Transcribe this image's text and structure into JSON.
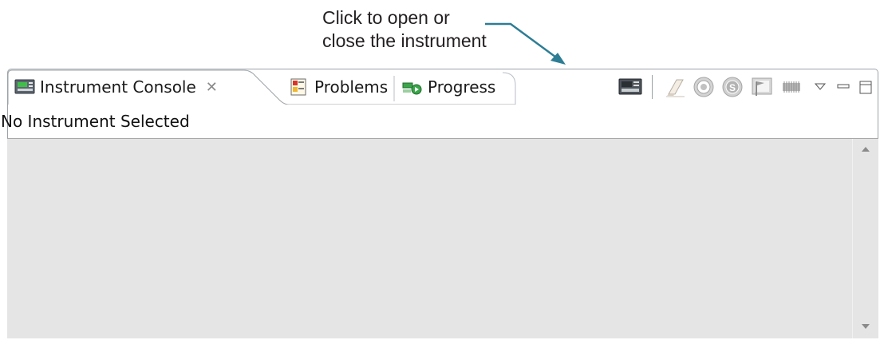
{
  "callout": {
    "line1": "Click to open or",
    "line2": "close the instrument"
  },
  "tabs": [
    {
      "label": "Instrument Console",
      "icon": "instrument-console-icon",
      "active": true,
      "close_glyph": "✕"
    },
    {
      "label": "Problems",
      "icon": "problems-icon",
      "active": false
    },
    {
      "label": "Progress",
      "icon": "progress-icon",
      "active": false
    }
  ],
  "toolbar": {
    "buttons": [
      {
        "name": "open-close-instrument-button",
        "icon": "instrument-icon"
      },
      {
        "name": "clear-console-button",
        "icon": "eraser-icon"
      },
      {
        "name": "connect-button",
        "icon": "target-icon"
      },
      {
        "name": "stop-button",
        "icon": "s-circle-icon"
      },
      {
        "name": "pin-console-button",
        "icon": "flag-display-icon"
      },
      {
        "name": "memory-button",
        "icon": "chip-icon"
      },
      {
        "name": "view-menu-button",
        "icon": "triangle-down-icon"
      },
      {
        "name": "minimize-button",
        "icon": "minimize-icon"
      },
      {
        "name": "maximize-button",
        "icon": "maximize-icon"
      }
    ]
  },
  "status": {
    "text": "No Instrument Selected"
  },
  "colors": {
    "arrow": "#2d7d95",
    "tab_border": "#9ca3a8",
    "console_bg": "#e5e5e5"
  }
}
